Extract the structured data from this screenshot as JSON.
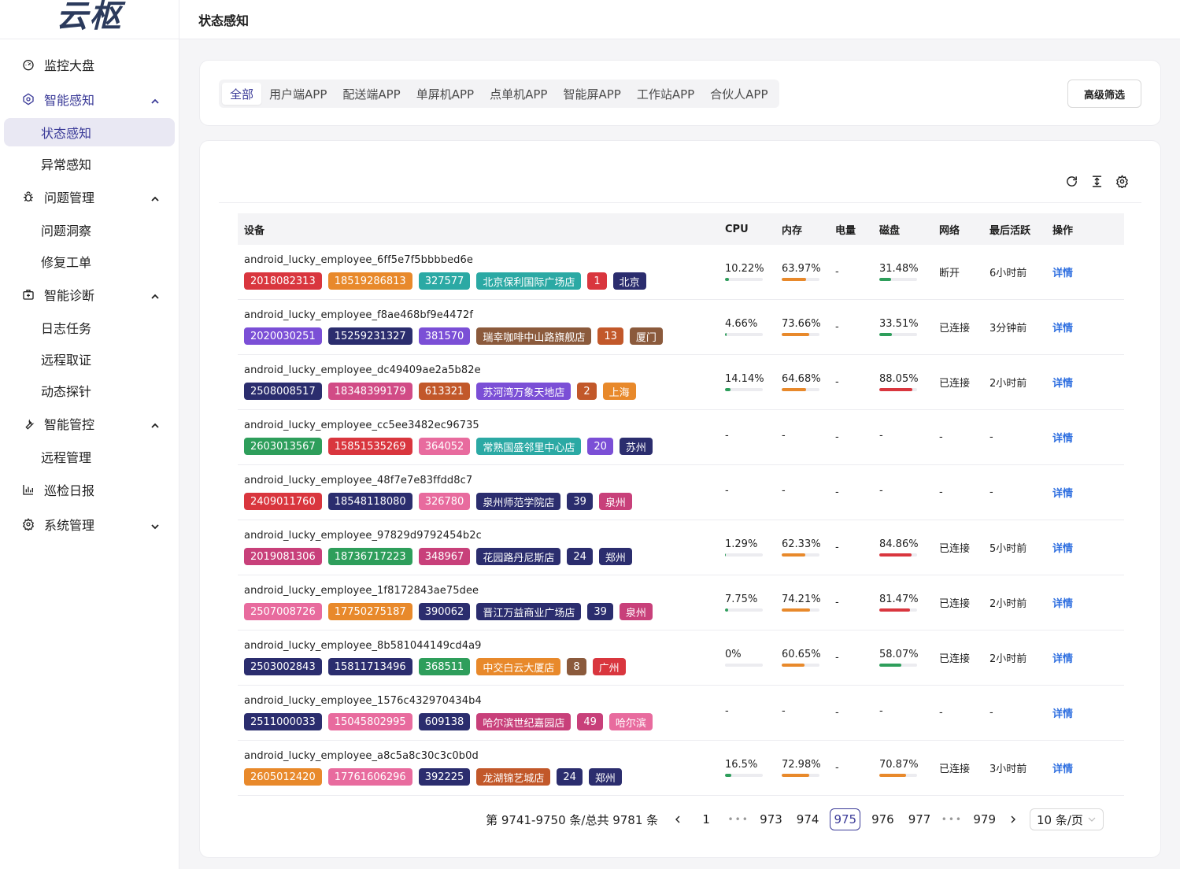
{
  "logo": "云枢",
  "header": {
    "title": "状态感知"
  },
  "sidebar": {
    "items": [
      {
        "id": "monitor",
        "label": "监控大盘",
        "icon": "dashboard-icon",
        "expand": ""
      },
      {
        "id": "smart-perception",
        "label": "智能感知",
        "icon": "perception-icon",
        "expand": "up",
        "active": true,
        "children": [
          {
            "label": "状态感知",
            "selected": true
          },
          {
            "label": "异常感知"
          }
        ]
      },
      {
        "id": "issue",
        "label": "问题管理",
        "icon": "bug-icon",
        "expand": "up",
        "children": [
          {
            "label": "问题洞察"
          },
          {
            "label": "修复工单"
          }
        ]
      },
      {
        "id": "diagnosis",
        "label": "智能诊断",
        "icon": "medkit-icon",
        "expand": "up",
        "children": [
          {
            "label": "日志任务"
          },
          {
            "label": "远程取证"
          },
          {
            "label": "动态探针"
          }
        ]
      },
      {
        "id": "control",
        "label": "智能管控",
        "icon": "wrench-icon",
        "expand": "up",
        "children": [
          {
            "label": "远程管理"
          }
        ]
      },
      {
        "id": "report",
        "label": "巡检日报",
        "icon": "bar-chart-icon",
        "expand": ""
      },
      {
        "id": "system",
        "label": "系统管理",
        "icon": "gear-icon",
        "expand": "down"
      }
    ]
  },
  "filters": {
    "tabs": [
      "全部",
      "用户端APP",
      "配送端APP",
      "单屏机APP",
      "点单机APP",
      "智能屏APP",
      "工作站APP",
      "合伙人APP"
    ],
    "active_tab": 0,
    "advanced_label": "高级筛选"
  },
  "toolbar": {
    "icons": [
      "refresh-icon",
      "column-height-icon",
      "settings-icon"
    ]
  },
  "table": {
    "headers": {
      "device": "设备",
      "cpu": "CPU",
      "mem": "内存",
      "battery": "电量",
      "disk": "磁盘",
      "network": "网络",
      "last_active": "最后活跃",
      "action": "操作"
    },
    "detail_label": "详情",
    "bar_colors": {
      "green": "#2e9e5b",
      "orange": "#e8892b",
      "red": "#d9363e"
    },
    "rows": [
      {
        "name": "android_lucky_employee_6ff5e7f5bbbbed6e",
        "tags": [
          {
            "text": "2018082313",
            "color": "#d9363e"
          },
          {
            "text": "18519286813",
            "color": "#e8892b"
          },
          {
            "text": "327577",
            "color": "#2ba9a4"
          },
          {
            "text": "北京保利国际广场店",
            "color": "#2ba9a4"
          },
          {
            "text": "1",
            "color": "#d9363e"
          },
          {
            "text": "北京",
            "color": "#2b2d6e"
          }
        ],
        "cpu": "10.22%",
        "cpu_val": 10.22,
        "cpu_color": "green",
        "mem": "63.97%",
        "mem_val": 63.97,
        "mem_color": "orange",
        "battery": "-",
        "disk": "31.48%",
        "disk_val": 31.48,
        "disk_color": "green",
        "network": "断开",
        "last": "6小时前"
      },
      {
        "name": "android_lucky_employee_f8ae468bf9e4472f",
        "tags": [
          {
            "text": "2020030251",
            "color": "#7b4fd6"
          },
          {
            "text": "15259231327",
            "color": "#2b2d6e"
          },
          {
            "text": "381570",
            "color": "#7b4fd6"
          },
          {
            "text": "瑞幸咖啡中山路旗舰店",
            "color": "#8b5a3c"
          },
          {
            "text": "13",
            "color": "#c2582a"
          },
          {
            "text": "厦门",
            "color": "#8b5a3c"
          }
        ],
        "cpu": "4.66%",
        "cpu_val": 4.66,
        "cpu_color": "green",
        "mem": "73.66%",
        "mem_val": 73.66,
        "mem_color": "orange",
        "battery": "-",
        "disk": "33.51%",
        "disk_val": 33.51,
        "disk_color": "green",
        "network": "已连接",
        "last": "3分钟前"
      },
      {
        "name": "android_lucky_employee_dc49409ae2a5b82e",
        "tags": [
          {
            "text": "2508008517",
            "color": "#2b2d6e"
          },
          {
            "text": "18348399179",
            "color": "#d14b86"
          },
          {
            "text": "613321",
            "color": "#c2582a"
          },
          {
            "text": "苏河湾万象天地店",
            "color": "#7b4fd6"
          },
          {
            "text": "2",
            "color": "#c2582a"
          },
          {
            "text": "上海",
            "color": "#e8892b"
          }
        ],
        "cpu": "14.14%",
        "cpu_val": 14.14,
        "cpu_color": "green",
        "mem": "64.68%",
        "mem_val": 64.68,
        "mem_color": "orange",
        "battery": "-",
        "disk": "88.05%",
        "disk_val": 88.05,
        "disk_color": "red",
        "network": "已连接",
        "last": "2小时前"
      },
      {
        "name": "android_lucky_employee_cc5ee3482ec96735",
        "tags": [
          {
            "text": "2603013567",
            "color": "#2e9e5b"
          },
          {
            "text": "15851535269",
            "color": "#d9363e"
          },
          {
            "text": "364052",
            "color": "#e86b9e"
          },
          {
            "text": "常熟国盛邻里中心店",
            "color": "#2ba9a4"
          },
          {
            "text": "20",
            "color": "#7b4fd6"
          },
          {
            "text": "苏州",
            "color": "#2b2d6e"
          }
        ],
        "cpu": "-",
        "mem": "-",
        "battery": "-",
        "disk": "-",
        "network": "-",
        "last": "-"
      },
      {
        "name": "android_lucky_employee_48f7e7e83ffdd8c7",
        "tags": [
          {
            "text": "2409011760",
            "color": "#d9363e"
          },
          {
            "text": "18548118080",
            "color": "#2b2d6e"
          },
          {
            "text": "326780",
            "color": "#e86b9e"
          },
          {
            "text": "泉州师范学院店",
            "color": "#2b2d6e"
          },
          {
            "text": "39",
            "color": "#2b2d6e"
          },
          {
            "text": "泉州",
            "color": "#c8407a"
          }
        ],
        "cpu": "-",
        "mem": "-",
        "battery": "-",
        "disk": "-",
        "network": "-",
        "last": "-"
      },
      {
        "name": "android_lucky_employee_97829d9792454b2c",
        "tags": [
          {
            "text": "2019081306",
            "color": "#c8407a"
          },
          {
            "text": "18736717223",
            "color": "#2e9e5b"
          },
          {
            "text": "348967",
            "color": "#c8407a"
          },
          {
            "text": "花园路丹尼斯店",
            "color": "#2b2d6e"
          },
          {
            "text": "24",
            "color": "#2b2d6e"
          },
          {
            "text": "郑州",
            "color": "#2b2d6e"
          }
        ],
        "cpu": "1.29%",
        "cpu_val": 1.29,
        "cpu_color": "green",
        "mem": "62.33%",
        "mem_val": 62.33,
        "mem_color": "orange",
        "battery": "-",
        "disk": "84.86%",
        "disk_val": 84.86,
        "disk_color": "red",
        "network": "已连接",
        "last": "5小时前"
      },
      {
        "name": "android_lucky_employee_1f8172843ae75dee",
        "tags": [
          {
            "text": "2507008726",
            "color": "#e86b9e"
          },
          {
            "text": "17750275187",
            "color": "#e8892b"
          },
          {
            "text": "390062",
            "color": "#2b2d6e"
          },
          {
            "text": "晋江万益商业广场店",
            "color": "#2b2d6e"
          },
          {
            "text": "39",
            "color": "#2b2d6e"
          },
          {
            "text": "泉州",
            "color": "#c8407a"
          }
        ],
        "cpu": "7.75%",
        "cpu_val": 7.75,
        "cpu_color": "green",
        "mem": "74.21%",
        "mem_val": 74.21,
        "mem_color": "orange",
        "battery": "-",
        "disk": "81.47%",
        "disk_val": 81.47,
        "disk_color": "red",
        "network": "已连接",
        "last": "2小时前"
      },
      {
        "name": "android_lucky_employee_8b581044149cd4a9",
        "tags": [
          {
            "text": "2503002843",
            "color": "#2b2d6e"
          },
          {
            "text": "15811713496",
            "color": "#2b2d6e"
          },
          {
            "text": "368511",
            "color": "#2e9e5b"
          },
          {
            "text": "中交白云大厦店",
            "color": "#e8892b"
          },
          {
            "text": "8",
            "color": "#8b5a3c"
          },
          {
            "text": "广州",
            "color": "#d9363e"
          }
        ],
        "cpu": "0%",
        "cpu_val": 0,
        "cpu_color": "green",
        "mem": "60.65%",
        "mem_val": 60.65,
        "mem_color": "orange",
        "battery": "-",
        "disk": "58.07%",
        "disk_val": 58.07,
        "disk_color": "green",
        "network": "已连接",
        "last": "2小时前"
      },
      {
        "name": "android_lucky_employee_1576c432970434b4",
        "tags": [
          {
            "text": "2511000033",
            "color": "#2b2d6e"
          },
          {
            "text": "15045802995",
            "color": "#e86b9e"
          },
          {
            "text": "609138",
            "color": "#2b2d6e"
          },
          {
            "text": "哈尔滨世纪嘉园店",
            "color": "#c8407a"
          },
          {
            "text": "49",
            "color": "#c8407a"
          },
          {
            "text": "哈尔滨",
            "color": "#e86b9e"
          }
        ],
        "cpu": "-",
        "mem": "-",
        "battery": "-",
        "disk": "-",
        "network": "-",
        "last": "-"
      },
      {
        "name": "android_lucky_employee_a8c5a8c30c3c0b0d",
        "tags": [
          {
            "text": "2605012420",
            "color": "#e8892b"
          },
          {
            "text": "17761606296",
            "color": "#e86b9e"
          },
          {
            "text": "392225",
            "color": "#2b2d6e"
          },
          {
            "text": "龙湖锦艺城店",
            "color": "#c2582a"
          },
          {
            "text": "24",
            "color": "#2b2d6e"
          },
          {
            "text": "郑州",
            "color": "#2b2d6e"
          }
        ],
        "cpu": "16.5%",
        "cpu_val": 16.5,
        "cpu_color": "green",
        "mem": "72.98%",
        "mem_val": 72.98,
        "mem_color": "orange",
        "battery": "-",
        "disk": "70.87%",
        "disk_val": 70.87,
        "disk_color": "orange",
        "network": "已连接",
        "last": "3小时前"
      }
    ]
  },
  "pagination": {
    "total_text": "第 9741-9750 条/总共 9781 条",
    "pages": [
      "1",
      "•••",
      "973",
      "974",
      "975",
      "976",
      "977",
      "•••",
      "979"
    ],
    "current": "975",
    "page_size": "10 条/页"
  }
}
